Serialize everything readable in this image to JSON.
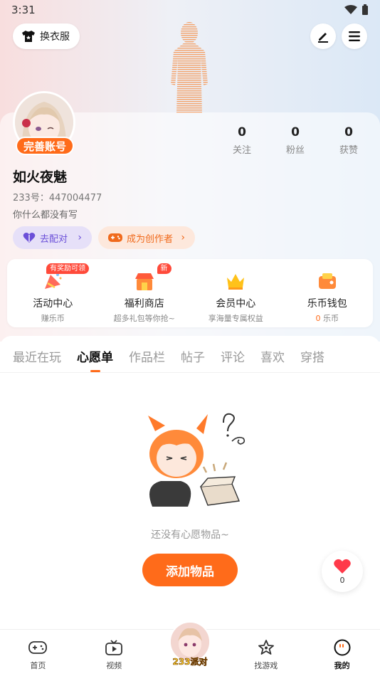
{
  "status_bar": {
    "time": "3:31"
  },
  "header": {
    "wardrobe_label": "换衣服",
    "edit_icon": "pen-icon",
    "menu_icon": "menu-icon"
  },
  "profile": {
    "complete_badge": "完善账号",
    "nickname": "如火夜魅",
    "uid": "233号：447004477",
    "bio": "你什么都没有写",
    "stats": [
      {
        "num": "0",
        "label": "关注"
      },
      {
        "num": "0",
        "label": "粉丝"
      },
      {
        "num": "0",
        "label": "获赞"
      }
    ],
    "match_label": "去配对",
    "creator_label": "成为创作者"
  },
  "services": [
    {
      "tag": "有奖励可领",
      "title": "活动中心",
      "sub": "赚乐币",
      "icon": "gift-horn-icon"
    },
    {
      "tag": "新",
      "title": "福利商店",
      "sub": "超多礼包等你抢~",
      "icon": "shop-icon"
    },
    {
      "tag": "",
      "title": "会员中心",
      "sub": "享海量专属权益",
      "icon": "crown-icon"
    },
    {
      "tag": "",
      "title": "乐币钱包",
      "sub_num": "0",
      "sub": "乐币",
      "icon": "wallet-icon"
    }
  ],
  "tabs": [
    "最近在玩",
    "心愿单",
    "作品栏",
    "帖子",
    "评论",
    "喜欢",
    "穿搭"
  ],
  "active_tab": "心愿单",
  "empty": {
    "text": "还没有心愿物品~",
    "button": "添加物品"
  },
  "like_float": {
    "count": "0"
  },
  "bottom_nav": {
    "home": "首页",
    "video": "视频",
    "party": "233派对",
    "find_games": "找游戏",
    "mine": "我的"
  },
  "colors": {
    "accent": "#ff6b1a",
    "purple": "#6b4fd8"
  }
}
